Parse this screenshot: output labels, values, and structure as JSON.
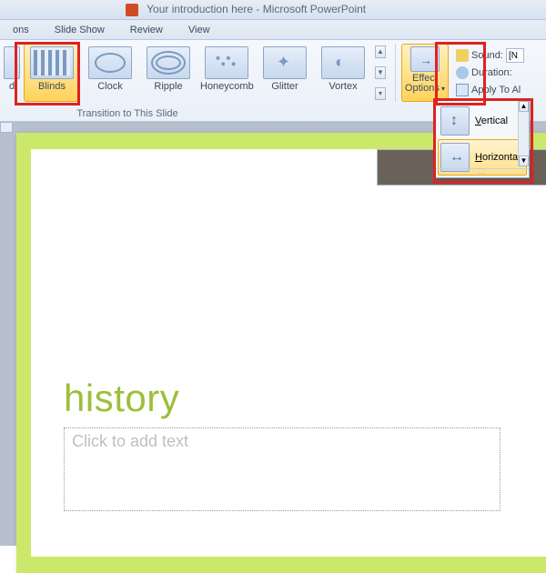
{
  "titlebar": {
    "text": "Your introduction here - Microsoft PowerPoint"
  },
  "tabs": {
    "t0": "ons",
    "t1": "Slide Show",
    "t2": "Review",
    "t3": "View"
  },
  "transitions": {
    "first_label": "d",
    "items": [
      {
        "label": "Blinds"
      },
      {
        "label": "Clock"
      },
      {
        "label": "Ripple"
      },
      {
        "label": "Honeycomb"
      },
      {
        "label": "Glitter"
      },
      {
        "label": "Vortex"
      }
    ],
    "group_label": "Transition to This Slide"
  },
  "effect_options": {
    "label_line1": "Effect",
    "label_line2": "Options",
    "menu": [
      {
        "label": "Vertical",
        "accel": "V"
      },
      {
        "label": "Horizontal",
        "accel": "H"
      }
    ]
  },
  "timing": {
    "sound_label": "Sound:",
    "sound_value": "[N",
    "duration_label": "Duration:",
    "apply_label": "Apply To Al"
  },
  "slide": {
    "title": "history",
    "content_placeholder": "Click to add text"
  }
}
